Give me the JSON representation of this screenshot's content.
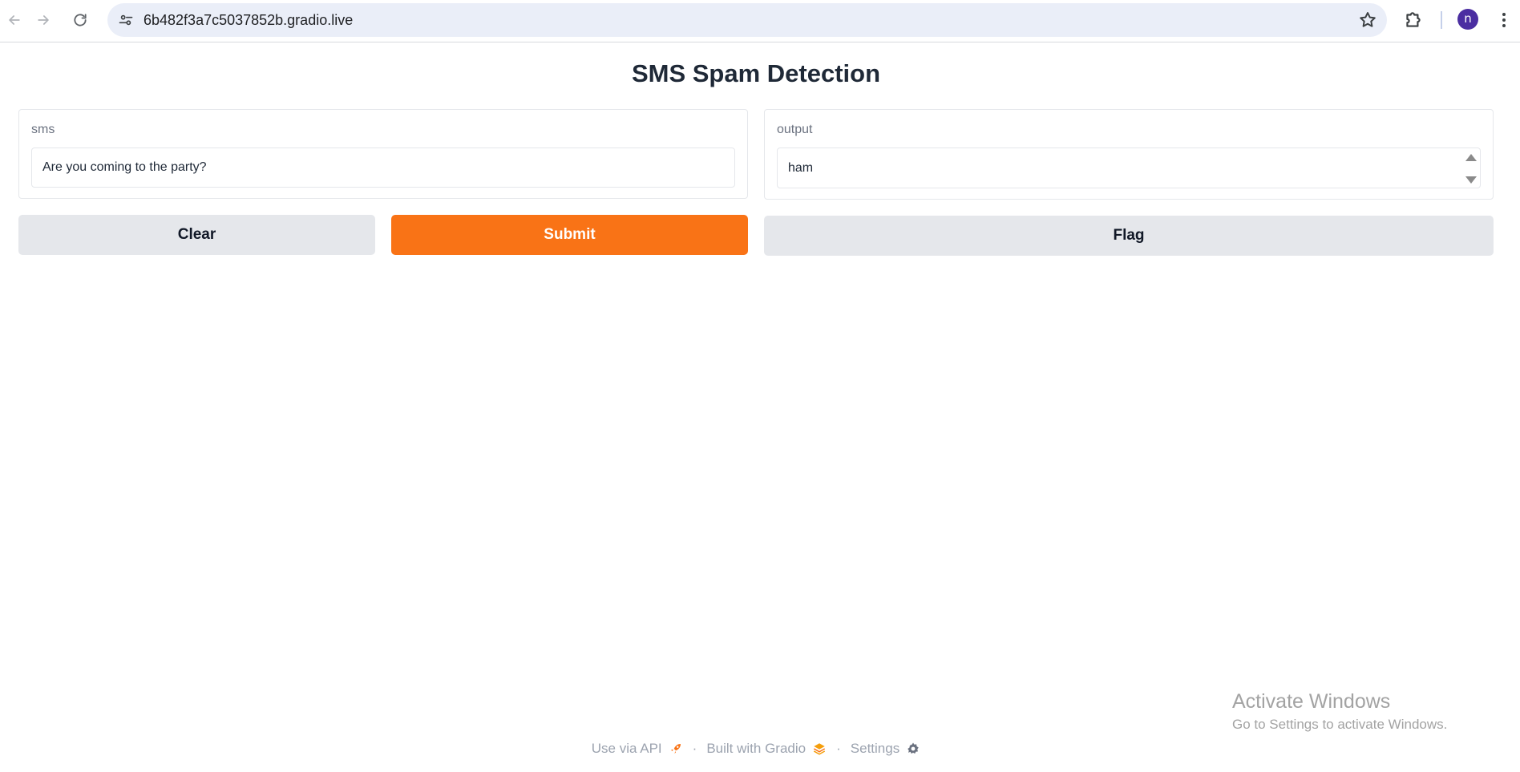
{
  "browser": {
    "url": "6b482f3a7c5037852b.gradio.live",
    "profile_initial": "n",
    "icons": {
      "back": "arrow-left-icon",
      "forward": "arrow-right-icon",
      "reload": "reload-icon",
      "site_info": "tune-icon",
      "bookmark": "star-icon",
      "extensions": "puzzle-icon",
      "menu": "kebab-menu-icon"
    }
  },
  "page": {
    "title": "SMS Spam Detection"
  },
  "input_panel": {
    "label": "sms",
    "value": "Are you coming to the party?"
  },
  "output_panel": {
    "label": "output",
    "value": "ham"
  },
  "buttons": {
    "clear": "Clear",
    "submit": "Submit",
    "flag": "Flag"
  },
  "footer": {
    "api_label": "Use via API",
    "built_label": "Built with Gradio",
    "settings_label": "Settings",
    "separator": "·"
  },
  "watermark": {
    "title": "Activate Windows",
    "subtitle": "Go to Settings to activate Windows."
  },
  "colors": {
    "accent": "#f97316",
    "secondary_button": "#e5e7eb",
    "avatar": "#4b2ea1"
  }
}
